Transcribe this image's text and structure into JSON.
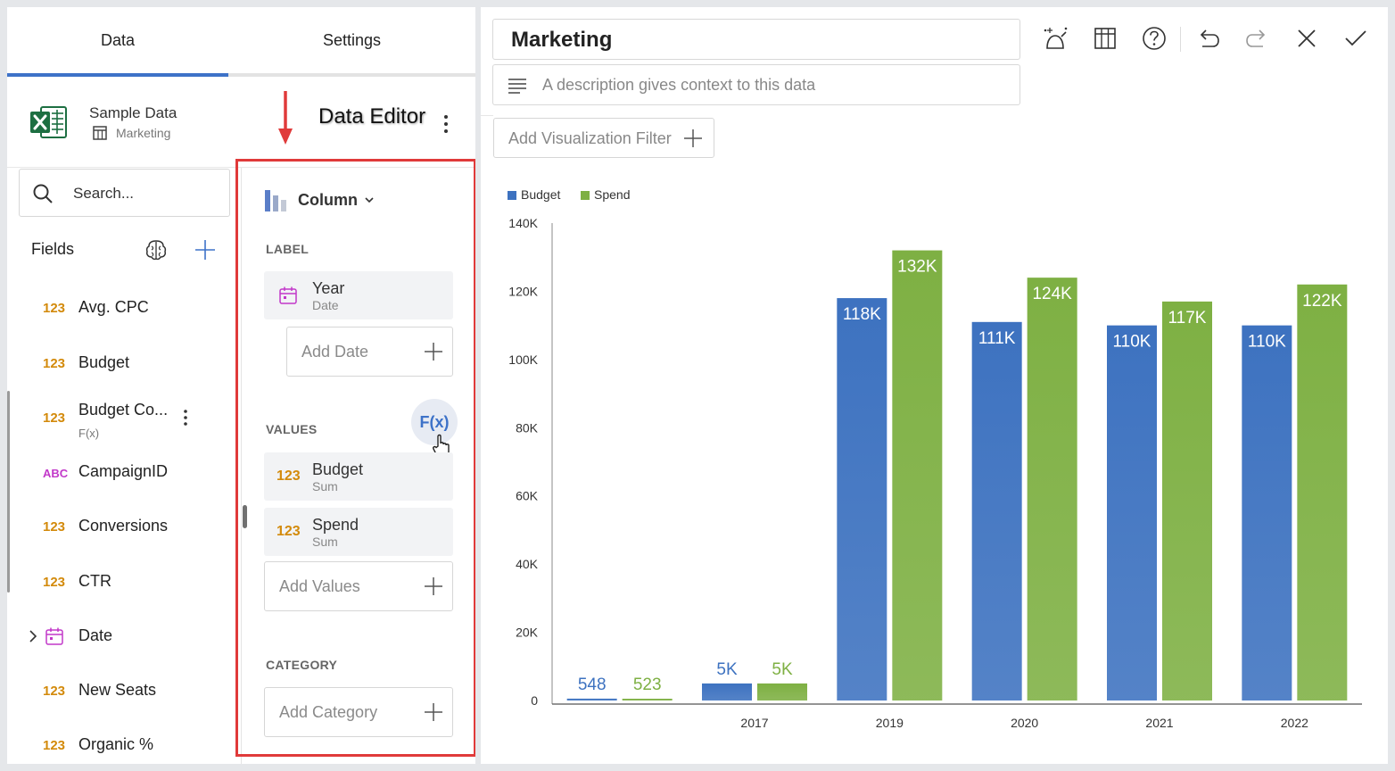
{
  "tabs": {
    "data": "Data",
    "settings": "Settings"
  },
  "source": {
    "name": "Sample Data",
    "sheet": "Marketing"
  },
  "editor_title": "Data Editor",
  "search": {
    "placeholder": "Search..."
  },
  "fields_title": "Fields",
  "fields": [
    {
      "type": "123",
      "name": "Avg. CPC",
      "sub": ""
    },
    {
      "type": "123",
      "name": "Budget",
      "sub": ""
    },
    {
      "type": "123",
      "name": "Budget Co...",
      "sub": "F(x)"
    },
    {
      "type": "ABC",
      "name": "CampaignID",
      "sub": ""
    },
    {
      "type": "123",
      "name": "Conversions",
      "sub": ""
    },
    {
      "type": "123",
      "name": "CTR",
      "sub": ""
    },
    {
      "type": "date",
      "name": "Date",
      "sub": ""
    },
    {
      "type": "123",
      "name": "New Seats",
      "sub": ""
    },
    {
      "type": "123",
      "name": "Organic %",
      "sub": ""
    }
  ],
  "editor": {
    "chart_type": "Column",
    "label_section": "LABEL",
    "label_field": {
      "name": "Year",
      "sub": "Date"
    },
    "add_date": "Add Date",
    "values_section": "VALUES",
    "fx": "F(x)",
    "values": [
      {
        "type": "123",
        "name": "Budget",
        "sub": "Sum"
      },
      {
        "type": "123",
        "name": "Spend",
        "sub": "Sum"
      }
    ],
    "add_values": "Add Values",
    "category_section": "CATEGORY",
    "add_category": "Add Category"
  },
  "right": {
    "title": "Marketing",
    "description_placeholder": "A description gives context to this data",
    "filter_label": "Add Visualization Filter"
  },
  "colors": {
    "accent": "#3d72c8",
    "budget": "#3d72c0",
    "spend": "#7eb043",
    "highlight": "#e03a3a",
    "number_type": "#d38a0b",
    "text_type": "#c238c9"
  },
  "chart_data": {
    "type": "bar",
    "categories": [
      "",
      "2017",
      "2019",
      "2020",
      "2021",
      "2022"
    ],
    "series": [
      {
        "name": "Budget",
        "values": [
          548,
          5000,
          118000,
          111000,
          110000,
          110000
        ],
        "labels": [
          "548",
          "5K",
          "118K",
          "111K",
          "110K",
          "110K"
        ]
      },
      {
        "name": "Spend",
        "values": [
          523,
          5000,
          132000,
          124000,
          117000,
          122000
        ],
        "labels": [
          "523",
          "5K",
          "132K",
          "124K",
          "117K",
          "122K"
        ]
      }
    ],
    "yticks": [
      "0",
      "20K",
      "40K",
      "60K",
      "80K",
      "100K",
      "120K",
      "140K"
    ],
    "ylim": [
      0,
      140000
    ],
    "legend": "top-left",
    "grid": false
  }
}
